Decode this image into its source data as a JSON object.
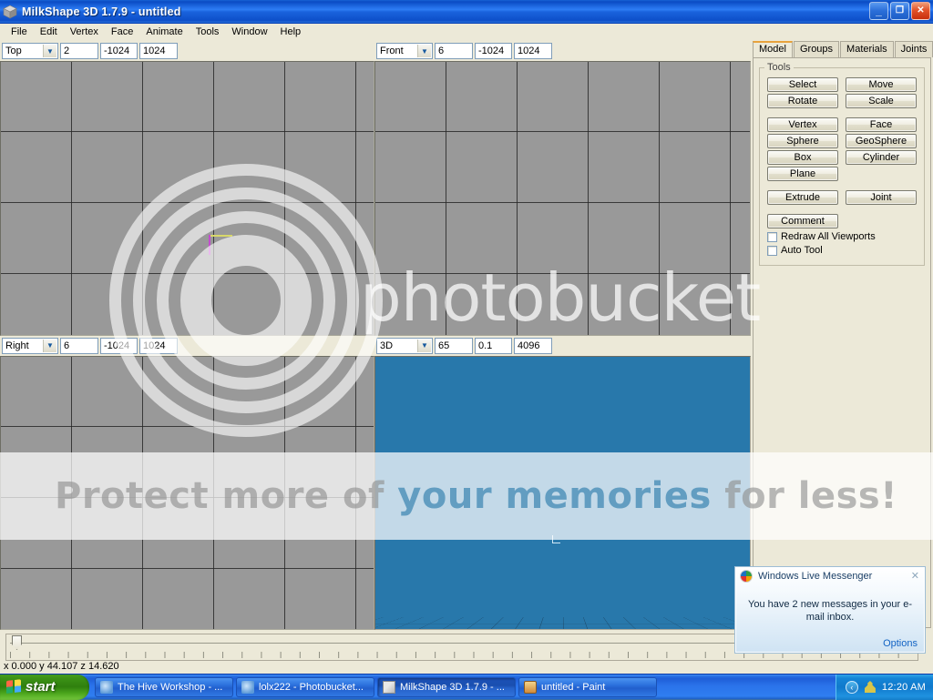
{
  "window": {
    "title": "MilkShape 3D 1.7.9 - untitled",
    "icon": "milkshape-cube-icon",
    "buttons": {
      "minimize": "_",
      "restore": "❐",
      "close": "✕"
    }
  },
  "menu": {
    "items": [
      "File",
      "Edit",
      "Vertex",
      "Face",
      "Animate",
      "Tools",
      "Window",
      "Help"
    ]
  },
  "viewports": [
    {
      "id": "top",
      "view": "Top",
      "field2": "2",
      "field3": "-1024",
      "field4": "1024",
      "type": "ortho"
    },
    {
      "id": "front",
      "view": "Front",
      "field2": "6",
      "field3": "-1024",
      "field4": "1024",
      "type": "ortho"
    },
    {
      "id": "right",
      "view": "Right",
      "field2": "6",
      "field3": "-1024",
      "field4": "1024",
      "type": "ortho"
    },
    {
      "id": "3d",
      "view": "3D",
      "field2": "65",
      "field3": "0.1",
      "field4": "4096",
      "type": "perspective"
    }
  ],
  "right_panel": {
    "tabs": [
      {
        "label": "Model",
        "active": true
      },
      {
        "label": "Groups",
        "active": false
      },
      {
        "label": "Materials",
        "active": false
      },
      {
        "label": "Joints",
        "active": false
      }
    ],
    "group_title": "Tools",
    "tool_rows": [
      [
        "Select",
        "Move"
      ],
      [
        "Rotate",
        "Scale"
      ]
    ],
    "primitive_rows": [
      [
        "Vertex",
        "Face"
      ],
      [
        "Sphere",
        "GeoSphere"
      ],
      [
        "Box",
        "Cylinder"
      ],
      [
        "Plane",
        ""
      ]
    ],
    "extrude_row": [
      "Extrude",
      "Joint"
    ],
    "comment_button": "Comment",
    "checkboxes": [
      {
        "label": "Redraw All Viewports",
        "checked": false
      },
      {
        "label": "Auto Tool",
        "checked": false
      }
    ]
  },
  "status_bar": {
    "coordinates": "x 0.000 y 44.107 z 14.620"
  },
  "notification": {
    "app": "Windows Live Messenger",
    "icon": "messenger-icon",
    "message": "You have 2 new messages in your e-mail inbox.",
    "options_link": "Options",
    "close": "✕"
  },
  "watermark": {
    "brand": "photobucket",
    "slogan_pre": "Protect more of ",
    "slogan_blue": "your memories",
    "slogan_post": " for less!"
  },
  "taskbar": {
    "start_label": "start",
    "tasks": [
      {
        "label": "The Hive Workshop - ...",
        "icon": "ie-icon",
        "active": false
      },
      {
        "label": "lolx222 - Photobucket...",
        "icon": "ie-icon",
        "active": false
      },
      {
        "label": "MilkShape 3D 1.7.9 - ...",
        "icon": "milkshape-icon",
        "active": true
      },
      {
        "label": "untitled - Paint",
        "icon": "paint-icon",
        "active": false
      }
    ],
    "tray": {
      "chevron": "‹",
      "clock": "12:20 AM"
    }
  },
  "colors": {
    "title_blue": "#0a4bc4",
    "panel_bg": "#ece9d8",
    "viewport_gray": "#999999",
    "viewport_3d_blue": "#2878ab",
    "accent_orange": "#e8a33d",
    "link_blue": "#1263c4"
  }
}
